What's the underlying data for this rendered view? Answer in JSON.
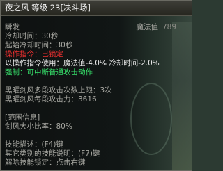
{
  "tooltip": {
    "title": "夜之风 等级 23[决斗场]",
    "skill_type": "瞬发",
    "mana_label": "魔法值",
    "mana_value": "789",
    "cooldown": "冷却时间：30秒",
    "start_cooldown": "起始冷却时间：30秒",
    "lock_label": "操作指令：已锁定",
    "command_use": "以操作指令使用：魔法值-4.0% 冷却时间-2.0%",
    "strong": "强制：可中断普通攻击动作",
    "attack_count": "黑曜剑风多段攻击次数上限：3次",
    "attack_power": "黑曜剑风每段攻击力：3616",
    "range_header": "[范围信息]",
    "range_ratio": "剑风大小比率：80%",
    "desc_key": "技能描述：(F4)键",
    "other_key": "其它类别的技能说明：(F7)键",
    "unlock_key": "解除技能锁定：点击右键"
  }
}
